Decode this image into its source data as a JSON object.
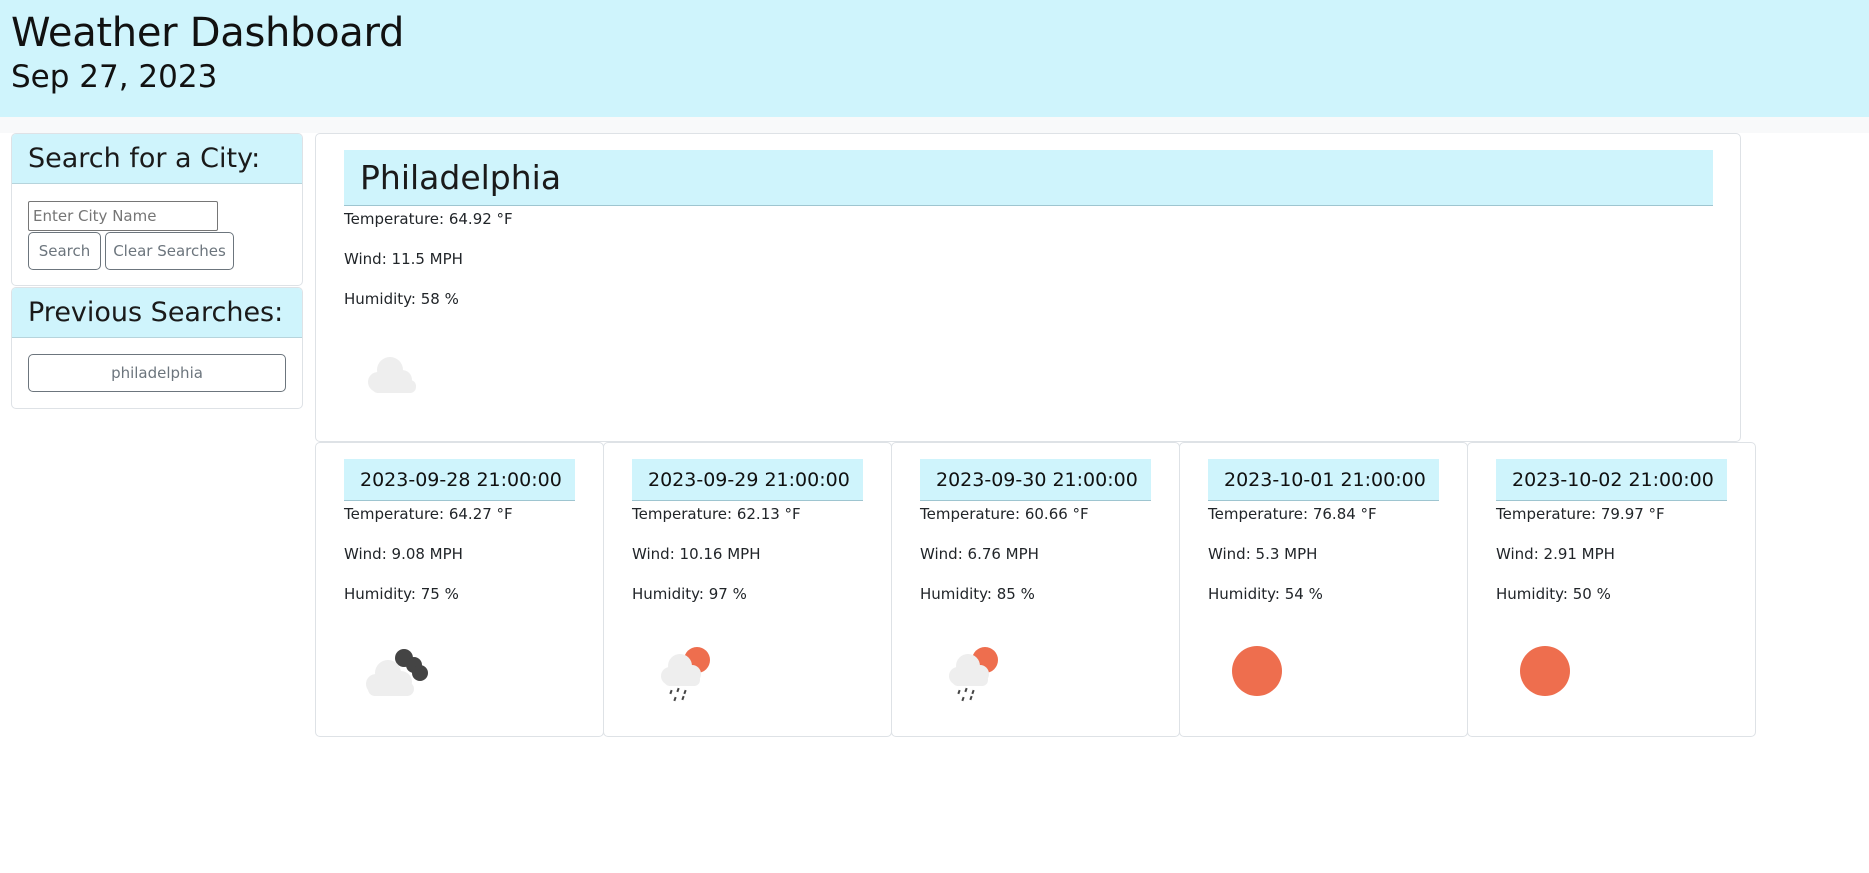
{
  "header": {
    "title": "Weather Dashboard",
    "date": "Sep 27, 2023"
  },
  "search": {
    "heading": "Search for a City:",
    "placeholder": "Enter City Name",
    "search_label": "Search",
    "clear_label": "Clear Searches"
  },
  "previous": {
    "heading": "Previous Searches:",
    "items": [
      "philadelphia"
    ]
  },
  "current": {
    "city": "Philadelphia",
    "temperature": "Temperature: 64.92 °F",
    "wind": "Wind: 11.5 MPH",
    "humidity": "Humidity: 58 %",
    "icon": "cloud-icon"
  },
  "forecast": [
    {
      "date": "2023-09-28 21:00:00",
      "temperature": "Temperature: 64.27 °F",
      "wind": "Wind: 9.08 MPH",
      "humidity": "Humidity: 75 %",
      "icon": "broken-clouds-icon"
    },
    {
      "date": "2023-09-29 21:00:00",
      "temperature": "Temperature: 62.13 °F",
      "wind": "Wind: 10.16 MPH",
      "humidity": "Humidity: 97 %",
      "icon": "rain-sun-icon"
    },
    {
      "date": "2023-09-30 21:00:00",
      "temperature": "Temperature: 60.66 °F",
      "wind": "Wind: 6.76 MPH",
      "humidity": "Humidity: 85 %",
      "icon": "rain-sun-icon"
    },
    {
      "date": "2023-10-01 21:00:00",
      "temperature": "Temperature: 76.84 °F",
      "wind": "Wind: 5.3 MPH",
      "humidity": "Humidity: 54 %",
      "icon": "sun-icon"
    },
    {
      "date": "2023-10-02 21:00:00",
      "temperature": "Temperature: 79.97 °F",
      "wind": "Wind: 2.91 MPH",
      "humidity": "Humidity: 50 %",
      "icon": "sun-icon"
    }
  ],
  "colors": {
    "accent": "#cff4fc",
    "sun": "#ee6e4e",
    "cloud": "#eeeeee",
    "dark_cloud": "#444444"
  }
}
